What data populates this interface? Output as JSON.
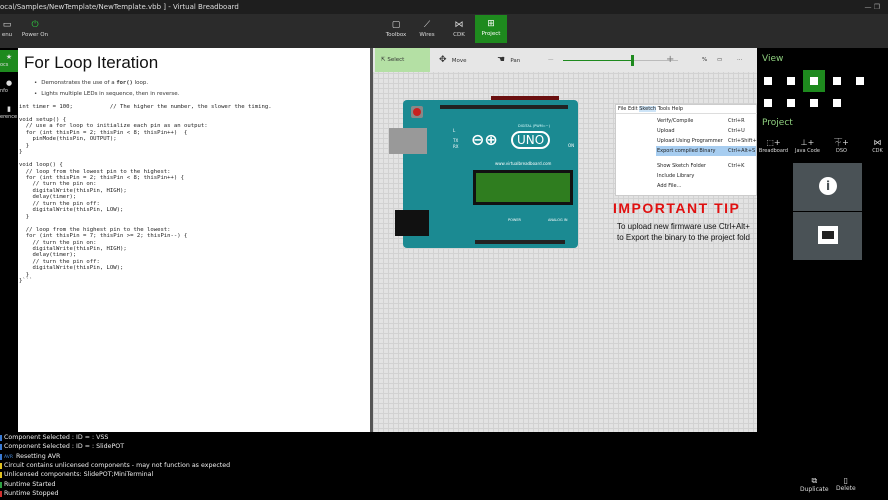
{
  "titlebar": {
    "title": "ocal/Samples/NewTemplate/NewTemplate.vbb ] - Virtual Breadboard",
    "controls": "—  ❐"
  },
  "toolbar": {
    "menu": "enu",
    "power": "Power On",
    "toolbox": "Toolbox",
    "wires": "Wires",
    "cdk": "CDK",
    "project": "Project"
  },
  "leftnav": {
    "items": [
      {
        "label": "ocs",
        "icon": "star-icon"
      },
      {
        "label": "nfo",
        "icon": "info-icon"
      },
      {
        "label": "erence",
        "icon": "book-icon"
      }
    ]
  },
  "docs": {
    "title": "For Loop Iteration",
    "bullet1_pre": "Demonstrates the use of a ",
    "bullet1_code": "for()",
    "bullet1_post": " loop.",
    "bullet2": "Lights multiple LEDs in sequence, then in reverse.",
    "code": "int timer = 100;           // The higher the number, the slower the timing.\n\nvoid setup() {\n  // use a for loop to initialize each pin as an output:\n  for (int thisPin = 2; thisPin < 8; thisPin++)  {\n    pinMode(thisPin, OUTPUT);\n  }\n}\n\nvoid loop() {\n  // loop from the lowest pin to the highest:\n  for (int thisPin = 2; thisPin < 8; thisPin++) {\n    // turn the pin on:\n    digitalWrite(thisPin, HIGH);\n    delay(timer);\n    // turn the pin off:\n    digitalWrite(thisPin, LOW);\n  }\n\n  // loop from the highest pin to the lowest:\n  for (int thisPin = 7; thisPin >= 2; thisPin--) {\n    // turn the pin on:\n    digitalWrite(thisPin, HIGH);\n    delay(timer);\n    // turn the pin off:\n    digitalWrite(thisPin, LOW);\n  }\n}```"
  },
  "canvas": {
    "select": "Select",
    "move": "Move",
    "pan": "Pan",
    "zoom_unit": "%",
    "more": "···",
    "zoom_fraction": 0.6,
    "board": {
      "logo": "UNO",
      "digital": "DIGITAL (PWM=~)",
      "url": "www.virtualbreadboard.com",
      "power": "POWER",
      "analog": "ANALOG IN",
      "on": "ON",
      "l": "L",
      "tx": "TX",
      "rx": "RX"
    },
    "menu": {
      "bar": [
        "File",
        "Edit",
        "Sketch",
        "Tools",
        "Help"
      ],
      "items": [
        {
          "label": "Verify/Compile",
          "shortcut": "Ctrl+R"
        },
        {
          "label": "Upload",
          "shortcut": "Ctrl+U"
        },
        {
          "label": "Upload Using Programmer",
          "shortcut": "Ctrl+Shift+"
        },
        {
          "label": "Export compiled Binary",
          "shortcut": "Ctrl+Alt+S"
        },
        {
          "label": "Show Sketch Folder",
          "shortcut": "Ctrl+K"
        },
        {
          "label": "Include Library",
          "shortcut": ""
        },
        {
          "label": "Add File...",
          "shortcut": ""
        }
      ]
    },
    "tip_title": "IMPORTANT TIP",
    "tip_line1": "To upload new firmware use Ctrl+Alt+",
    "tip_line2": "to Export the binary to the project fold"
  },
  "right": {
    "view_title": "View",
    "project_title": "Project",
    "project_buttons": [
      {
        "label": "Breadboard",
        "icon": "breadboard-add-icon"
      },
      {
        "label": "Java Code",
        "icon": "java-add-icon"
      },
      {
        "label": "DSO",
        "icon": "dso-add-icon"
      },
      {
        "label": "CDK",
        "icon": "cdk-icon"
      }
    ]
  },
  "log": {
    "lines": [
      {
        "text": "Component Selected : ID =  : VSS",
        "color": "#3a7bd5"
      },
      {
        "text": "Component Selected : ID =  : SlidePOT",
        "color": "#3a7bd5"
      },
      {
        "badge": "AVR",
        "text": "Resetting AVR",
        "color": "#3a7bd5"
      },
      {
        "text": "Circuit contains unlicensed components - may not function as expected",
        "color": "#e0c020"
      },
      {
        "text": "Unlicensed components: SlidePOT;MiniTerminal",
        "color": "#e0c020"
      },
      {
        "text": "Runtime Started",
        "color": "#2ea043"
      },
      {
        "text": "Runtime Stopped",
        "color": "#d03030"
      }
    ]
  },
  "actions": {
    "duplicate": "Duplicate",
    "delete": "Delete"
  },
  "colors": {
    "accent": "#1e8a1e",
    "tip": "#e01010",
    "board": "#1b8a92"
  }
}
